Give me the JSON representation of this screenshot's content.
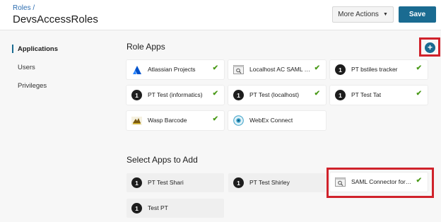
{
  "header": {
    "breadcrumb": "Roles /",
    "title": "DevsAccessRoles",
    "more_actions": "More Actions",
    "save": "Save"
  },
  "sidebar": {
    "items": [
      {
        "label": "Applications",
        "active": true
      },
      {
        "label": "Users",
        "active": false
      },
      {
        "label": "Privileges",
        "active": false
      }
    ]
  },
  "role_apps": {
    "title": "Role Apps",
    "add_icon": "plus-icon",
    "apps": [
      {
        "name": "Atlassian Projects",
        "icon": "atlassian-icon",
        "checked": true
      },
      {
        "name": "Localhost AC SAML T...",
        "icon": "saml-connector-icon",
        "checked": true
      },
      {
        "name": "PT bstiles tracker",
        "icon": "onelogin-icon",
        "checked": true
      },
      {
        "name": "PT Test (informatics)",
        "icon": "onelogin-icon",
        "checked": true
      },
      {
        "name": "PT Test (localhost)",
        "icon": "onelogin-icon",
        "checked": true
      },
      {
        "name": "PT Test Tat",
        "icon": "onelogin-icon",
        "checked": true
      },
      {
        "name": "Wasp Barcode",
        "icon": "wasp-barcode-icon",
        "checked": true
      },
      {
        "name": "WebEx Connect",
        "icon": "webex-icon",
        "checked": true
      }
    ]
  },
  "select_apps": {
    "title": "Select Apps to Add",
    "apps": [
      {
        "name": "PT Test Shari",
        "icon": "onelogin-icon",
        "checked": false
      },
      {
        "name": "PT Test Shirley",
        "icon": "onelogin-icon",
        "checked": false
      },
      {
        "name": "SAML Connector for ...",
        "icon": "saml-connector-icon",
        "checked": true
      },
      {
        "name": "Test PT",
        "icon": "onelogin-icon",
        "checked": false
      }
    ]
  },
  "colors": {
    "accent": "#1a6b91",
    "check": "#4a9a19",
    "highlight": "#d0222b"
  }
}
